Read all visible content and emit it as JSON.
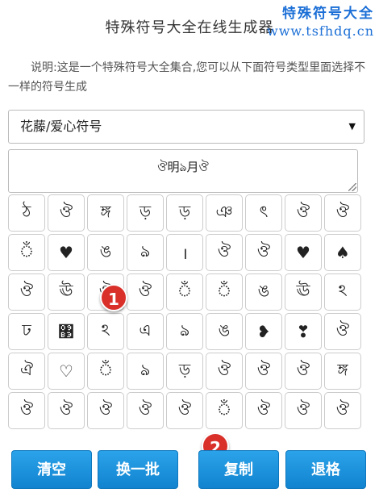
{
  "header": {
    "title": "特殊符号大全在线生成器",
    "watermark_line1": "特殊符号大全",
    "watermark_line2": "www.tsfhdq.cn"
  },
  "description": "说明:这是一个特殊符号大全集合,您可以从下面符号类型里面选择不一样的符号生成",
  "category_select": {
    "selected": "花藤/爱心符号"
  },
  "output": {
    "value": "ঔ明ঌ月ঔ"
  },
  "symbols": [
    "ঠ",
    "ঔ",
    "ঙ্গ",
    "ড়",
    "ড়",
    "ঞ",
    "ৎ",
    "ঔ",
    "ঔ",
    "ঁ",
    "♥",
    "ঙ",
    "ঌ",
    "।",
    "ঔ",
    "ঔ",
    "♥",
    "♠",
    "ঔ",
    "ঊ",
    "ঔ",
    "ঔ",
    "ঁ",
    "ঁ",
    "ঙ",
    "ঊ",
    "ঽ",
    "ঢ",
    "঳",
    "ঽ",
    "এ",
    "ঌ",
    "ঙ",
    "❥",
    "❣",
    "ঔ",
    "ঐ",
    "♡",
    "ঁ",
    "ঌ",
    "ড়",
    "ঔ",
    "ঔ",
    "ঔ",
    "ঙ্গ",
    "ঔ",
    "ঔ",
    "ঔ",
    "ঔ",
    "ঔ",
    "ঁ",
    "ঔ",
    "ঔ",
    "ঔ"
  ],
  "annotations": [
    "1",
    "2"
  ],
  "buttons": {
    "clear": "清空",
    "shuffle": "换一批",
    "copy": "复制",
    "back": "退格"
  },
  "colors": {
    "button": "#1a8fdc",
    "badge": "#d9302a",
    "watermark": "#1b6fd6"
  }
}
